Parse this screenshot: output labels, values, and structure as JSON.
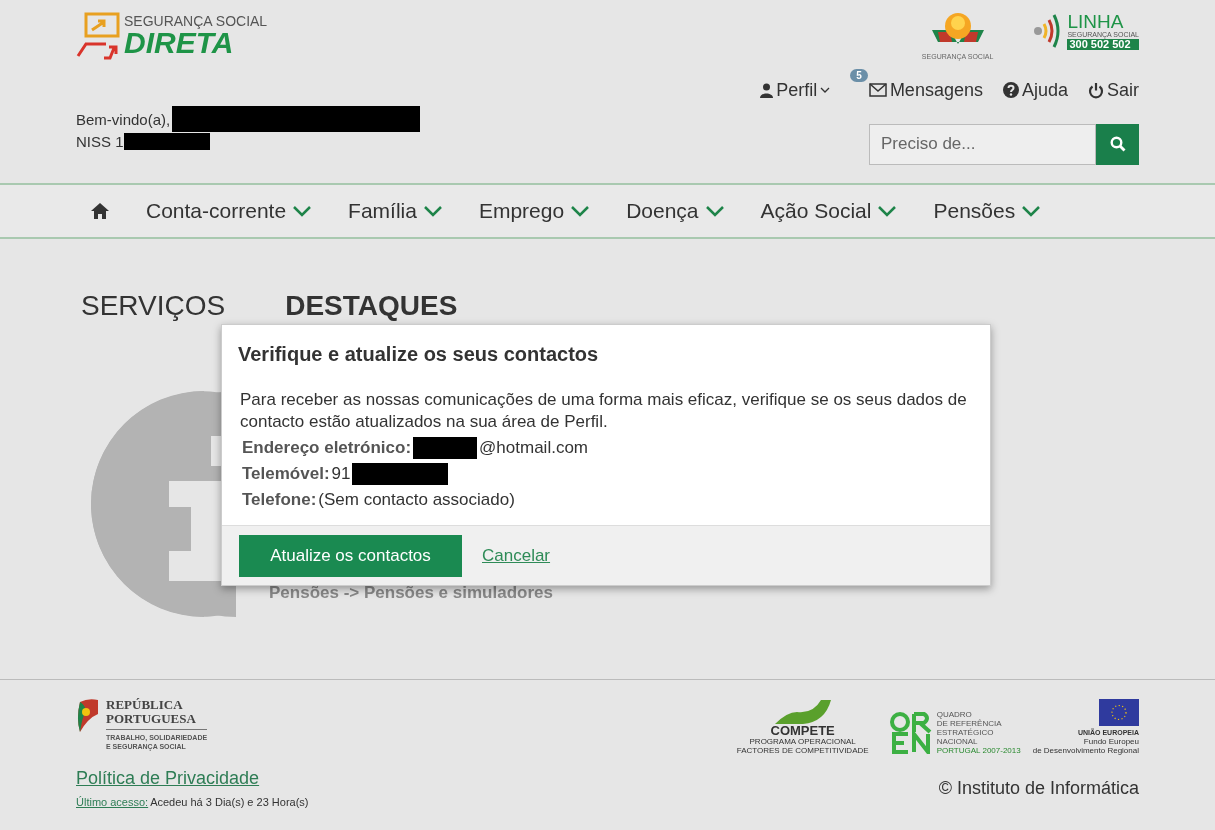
{
  "header": {
    "logo": {
      "top": "SEGURANÇA SOCIAL",
      "main": "DIRETA"
    },
    "emblem_caption": "SEGURANÇA SOCIAL",
    "hotline": {
      "title": "LINHA",
      "subtitle": "SEGURANÇA SOCIAL",
      "number": "300 502 502"
    },
    "user_menu": [
      {
        "kind": "profile",
        "label": "Perfil"
      },
      {
        "kind": "messages",
        "label": "Mensagens",
        "badge": "5"
      },
      {
        "kind": "help",
        "label": "Ajuda"
      },
      {
        "kind": "logout",
        "label": "Sair"
      }
    ],
    "welcome": "Bem-vindo(a),",
    "niss": "NISS 1",
    "search": {
      "placeholder": "Preciso de..."
    }
  },
  "nav": {
    "items": [
      "Conta-corrente",
      "Família",
      "Emprego",
      "Doença",
      "Ação Social",
      "Pensões"
    ]
  },
  "sections": {
    "tabs": [
      {
        "label": "SERVIÇOS",
        "selected": false
      },
      {
        "label": "DESTAQUES",
        "selected": true
      }
    ],
    "highlight_link": "Pensões -> Pensões e simuladores"
  },
  "modal": {
    "title": "Verifique e atualize os seus contactos",
    "message": "Para receber as nossas comunicações de uma forma mais eficaz, verifique se os seus dados de contacto estão atualizados na sua área de Perfil.",
    "fields": [
      {
        "label": "Endereço eletrónico:",
        "value": "@hotmail.com",
        "redacted_prefix": true
      },
      {
        "label": "Telemóvel:",
        "value": "91",
        "redacted_suffix": true
      },
      {
        "label": "Telefone:",
        "value": "(Sem contacto associado)"
      }
    ],
    "primary_button": "Atualize os contactos",
    "cancel_link": "Cancelar"
  },
  "footer": {
    "gov_logo": {
      "line1": "REPÚBLICA",
      "line2": "PORTUGUESA",
      "sub1": "TRABALHO, SOLIDARIEDADE",
      "sub2": "E SEGURANÇA SOCIAL"
    },
    "privacy_link": "Política de Privacidade",
    "last_access_label": "Último acesso:",
    "last_access_text": "Acedeu há 3 Dia(s) e 23 Hora(s)",
    "funding": {
      "compete": "COMPETE",
      "compete_sub": "PROGRAMA OPERACIONAL FACTORES DE COMPETITIVIDADE",
      "qren": [
        "QUADRO",
        "DE REFERÊNCIA",
        "ESTRATÉGICO",
        "NACIONAL"
      ],
      "qren_sub": "PORTUGAL 2007-2013",
      "eu": "UNIÃO EUROPEIA",
      "eu_sub": [
        "Fundo Europeu",
        "de Desenvolvimento Regional"
      ]
    },
    "copyright": "© Instituto de Informática"
  }
}
